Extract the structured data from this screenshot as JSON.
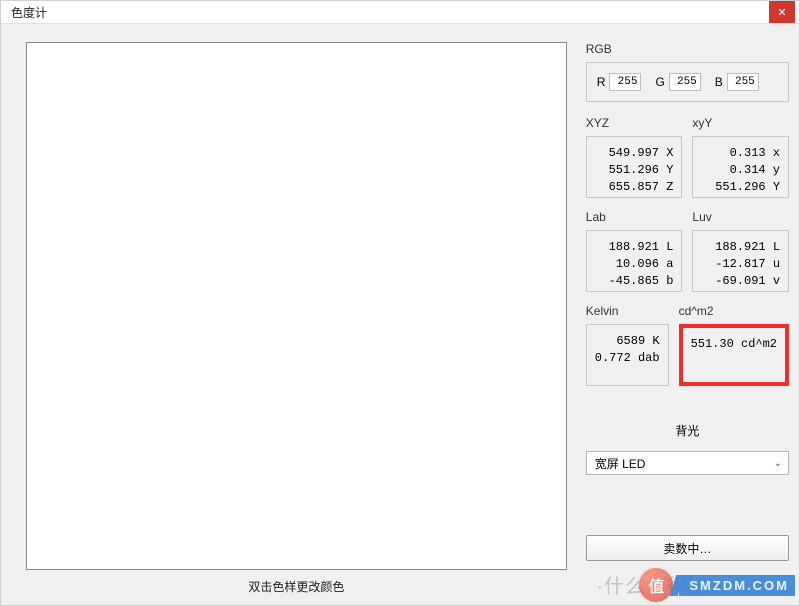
{
  "window": {
    "title": "色度计",
    "close_glyph": "✕"
  },
  "swatch": {
    "hint": "双击色样更改颜色"
  },
  "rgb": {
    "label": "RGB",
    "r_label": "R",
    "r_value": "255",
    "g_label": "G",
    "g_value": "255",
    "b_label": "B",
    "b_value": "255"
  },
  "xyz": {
    "label": "XYZ",
    "line1": "549.997 X",
    "line2": "551.296 Y",
    "line3": "655.857 Z"
  },
  "xyY": {
    "label": "xyY",
    "line1": "0.313 x",
    "line2": "0.314 y",
    "line3": "551.296 Y"
  },
  "lab": {
    "label": "Lab",
    "line1": "188.921 L",
    "line2": "10.096 a",
    "line3": "-45.865 b"
  },
  "luv": {
    "label": "Luv",
    "line1": "188.921 L",
    "line2": "-12.817 u",
    "line3": "-69.091 v"
  },
  "kelvin": {
    "label": "Kelvin",
    "line1": "6589 K",
    "line2": "0.772 dab",
    "line3": ""
  },
  "cdm2": {
    "label": "cd^m2",
    "line1": "551.30 cd^m2",
    "line2": "",
    "line3": ""
  },
  "backlight": {
    "label": "背光",
    "selected": "宽屏 LED"
  },
  "footer": {
    "reading_label": "卖数中…"
  },
  "watermark": {
    "badge": "值",
    "ghost": "·什么值得买",
    "tag": "SMZDM.COM"
  }
}
